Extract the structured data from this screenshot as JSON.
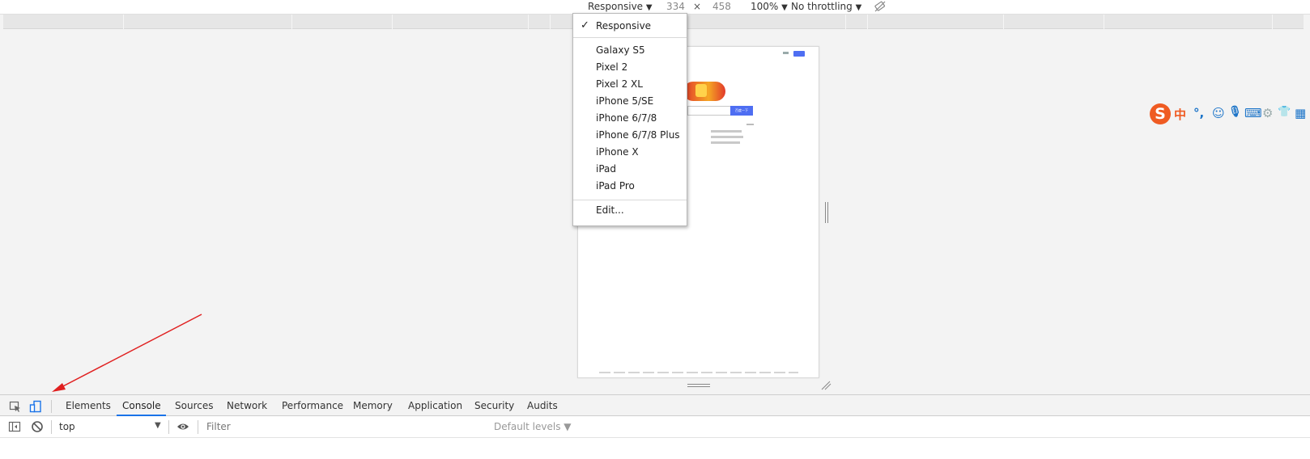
{
  "device_toolbar": {
    "device": "Responsive",
    "width": "334",
    "times": "×",
    "height": "458",
    "zoom": "100%",
    "throttling": "No throttling",
    "caret": "▼",
    "rotate_icon": "rotate-icon"
  },
  "device_menu": {
    "check": "✓",
    "selected": "Responsive",
    "devices": [
      "Galaxy S5",
      "Pixel 2",
      "Pixel 2 XL",
      "iPhone 5/SE",
      "iPhone 6/7/8",
      "iPhone 6/7/8 Plus",
      "iPhone X",
      "iPad",
      "iPad Pro"
    ],
    "edit": "Edit..."
  },
  "ime_toolbar": {
    "logo": "S",
    "chinese": "中",
    "punctuation": "°,",
    "emoji": "☺",
    "mic": "🎙",
    "keyboard": "⌨",
    "tools": "⚙",
    "skin": "👕",
    "more": "▦"
  },
  "devtools": {
    "tabs": [
      "Elements",
      "Console",
      "Sources",
      "Network",
      "Performance",
      "Memory",
      "Application",
      "Security",
      "Audits"
    ],
    "active_tab": "Console",
    "accent_color": "#1a73e8"
  },
  "console_toolbar": {
    "context": "top",
    "caret": "▼",
    "filter_placeholder": "Filter",
    "levels": "Default levels ▼"
  },
  "annotation": {
    "arrow_color": "#e02020"
  },
  "emulated_page": {
    "search_button": "百度一下"
  }
}
